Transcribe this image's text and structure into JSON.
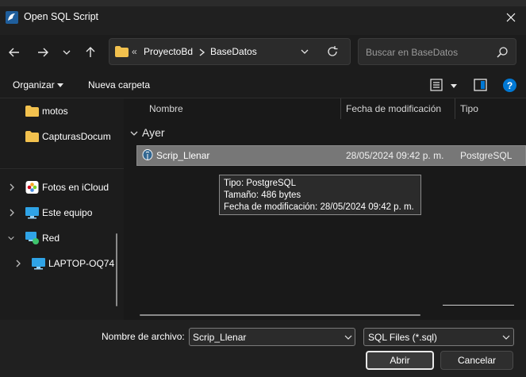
{
  "window": {
    "title": "Open SQL Script"
  },
  "address": {
    "crumbs": [
      "ProyectoBd",
      "BaseDatos"
    ],
    "overflow_glyph": "«"
  },
  "search": {
    "placeholder": "Buscar en BaseDatos"
  },
  "toolbar": {
    "organize_label": "Organizar",
    "new_folder_label": "Nueva carpeta"
  },
  "sidebar": {
    "items": [
      {
        "label": "motos",
        "icon": "folder-icon"
      },
      {
        "label": "CapturasDocum",
        "icon": "folder-icon"
      },
      {
        "label": "Fotos en iCloud",
        "icon": "icloud-photos-icon"
      },
      {
        "label": "Este equipo",
        "icon": "computer-icon"
      },
      {
        "label": "Red",
        "icon": "network-icon"
      },
      {
        "label": "LAPTOP-OQ74",
        "icon": "computer-icon"
      }
    ]
  },
  "files": {
    "columns": [
      "Nombre",
      "Fecha de modificación",
      "Tipo"
    ],
    "group": "Ayer",
    "rows": [
      {
        "name": "Scrip_Llenar",
        "date": "28/05/2024 09:42 p. m.",
        "type": "PostgreSQL",
        "icon": "postgresql-icon"
      }
    ]
  },
  "tooltip": {
    "lines": [
      "Tipo: PostgreSQL",
      "Tamaño: 486 bytes",
      "Fecha de modificación: 28/05/2024 09:42 p. m."
    ]
  },
  "footer": {
    "filename_label": "Nombre de archivo:",
    "filename_value": "Scrip_Llenar",
    "filetype_value": "SQL Files (*.sql)",
    "open_label": "Abrir",
    "cancel_label": "Cancelar"
  },
  "colors": {
    "accent": "#0078d4",
    "folder": "#f2c14e",
    "selection": "#777777"
  }
}
